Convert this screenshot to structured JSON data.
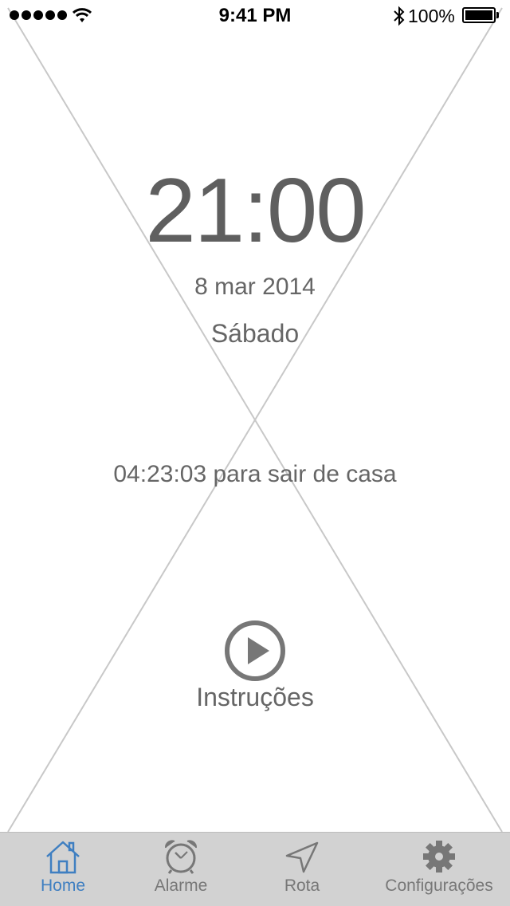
{
  "status_bar": {
    "time": "9:41 PM",
    "battery": "100%",
    "signal_icon": "signal-dots-icon",
    "wifi_icon": "wifi-icon",
    "bluetooth_icon": "bluetooth-icon",
    "battery_icon": "battery-icon"
  },
  "clock": {
    "time": "21:00",
    "date": "8 mar 2014",
    "weekday": "Sábado"
  },
  "countdown": {
    "text": "04:23:03 para sair de casa"
  },
  "instructions": {
    "label": "Instruções",
    "icon": "play-circle-icon"
  },
  "tabs": [
    {
      "label": "Home",
      "icon": "home-icon",
      "active": true
    },
    {
      "label": "Alarme",
      "icon": "alarm-clock-icon",
      "active": false
    },
    {
      "label": "Rota",
      "icon": "navigation-arrow-icon",
      "active": false
    },
    {
      "label": "Configurações",
      "icon": "gear-icon",
      "active": false
    }
  ],
  "colors": {
    "text": "#666666",
    "active_tab": "#3f7fc1",
    "tab_bar_bg": "#d2d2d2"
  }
}
